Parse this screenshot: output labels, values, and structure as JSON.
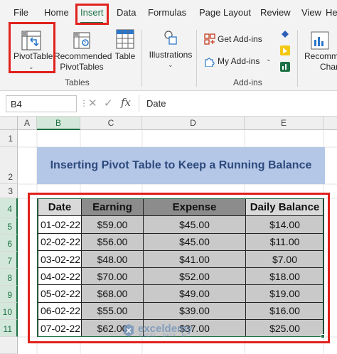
{
  "ribbon_tabs": [
    "File",
    "Home",
    "Insert",
    "Data",
    "Formulas",
    "Page Layout",
    "Review",
    "View",
    "He"
  ],
  "active_tab": "Insert",
  "ribbon": {
    "pivottable_label": "PivotTable",
    "recommended_label_1": "Recommended",
    "recommended_label_2": "PivotTables",
    "table_label": "Table",
    "tables_group_label": "Tables",
    "illustrations_label": "Illustrations",
    "get_addins_label": "Get Add-ins",
    "my_addins_label": "My Add-ins",
    "addins_group_label": "Add-ins",
    "recommended_charts_label_1": "Recomme",
    "recommended_charts_label_2": "Char"
  },
  "formula_bar": {
    "name_box": "B4",
    "cancel_glyph": "✕",
    "enter_glyph": "✓",
    "fx_label": "fx",
    "content": "Date"
  },
  "grid": {
    "columns": [
      "A",
      "B",
      "C",
      "D",
      "E"
    ],
    "rows": [
      "1",
      "2",
      "3",
      "4",
      "5",
      "6",
      "7",
      "8",
      "9",
      "10",
      "11"
    ],
    "selected_column": "B",
    "title": "Inserting Pivot Table to Keep a Running Balance"
  },
  "table": {
    "headers": [
      "Date",
      "Earning",
      "Expense",
      "Daily Balance"
    ],
    "rows": [
      [
        "01-02-22",
        "$59.00",
        "$45.00",
        "$14.00"
      ],
      [
        "02-02-22",
        "$56.00",
        "$45.00",
        "$11.00"
      ],
      [
        "03-02-22",
        "$48.00",
        "$41.00",
        "$7.00"
      ],
      [
        "04-02-22",
        "$70.00",
        "$52.00",
        "$18.00"
      ],
      [
        "05-02-22",
        "$68.00",
        "$49.00",
        "$19.00"
      ],
      [
        "06-02-22",
        "$55.00",
        "$39.00",
        "$16.00"
      ],
      [
        "07-02-22",
        "$62.00",
        "$37.00",
        "$25.00"
      ]
    ]
  },
  "watermark": {
    "text": "exceldemy",
    "sub": "EXCEL · DATA · BI"
  },
  "colors": {
    "excel_green": "#1e7145",
    "highlight_red": "#e0211d",
    "title_fill": "#b4c7e7",
    "header_dark": "#8c8c8c",
    "body_gray": "#c9c9c9"
  }
}
